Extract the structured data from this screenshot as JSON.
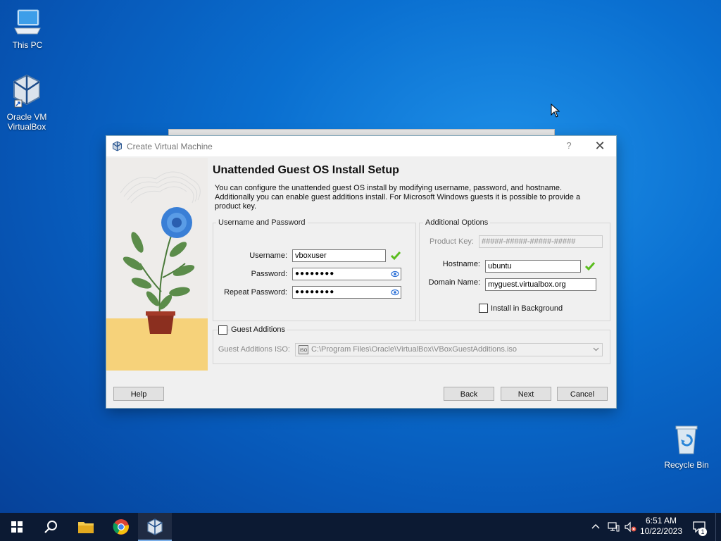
{
  "desktop": {
    "icons": [
      {
        "label": "This PC"
      },
      {
        "label": "Oracle VM VirtualBox"
      },
      {
        "label": "Recycle Bin"
      }
    ]
  },
  "dialog": {
    "title": "Create Virtual Machine",
    "help_glyph": "?",
    "close_glyph": "✕",
    "heading": "Unattended Guest OS Install Setup",
    "description": "You can configure the unattended guest OS install by modifying username, password, and hostname. Additionally you can enable guest additions install. For Microsoft Windows guests it is possible to provide a product key.",
    "user_group": {
      "title": "Username and Password",
      "username_label": "Username:",
      "username_value": "vboxuser",
      "password_label": "Password:",
      "password_value": "●●●●●●●●",
      "repeat_label": "Repeat Password:",
      "repeat_value": "●●●●●●●●"
    },
    "options_group": {
      "title": "Additional Options",
      "product_key_label": "Product Key:",
      "product_key_placeholder": "#####-#####-#####-#####",
      "hostname_label": "Hostname:",
      "hostname_value": "ubuntu",
      "domain_label": "Domain Name:",
      "domain_value": "myguest.virtualbox.org",
      "install_bg_label": "Install in Background",
      "install_bg_checked": false
    },
    "guest_additions": {
      "label": "Guest Additions",
      "checked": false,
      "iso_label": "Guest Additions ISO:",
      "iso_path": "C:\\Program Files\\Oracle\\VirtualBox\\VBoxGuestAdditions.iso"
    },
    "buttons": {
      "help": "Help",
      "back": "Back",
      "next": "Next",
      "cancel": "Cancel"
    }
  },
  "taskbar": {
    "time": "6:51 AM",
    "date": "10/22/2023",
    "notification_count": "1"
  },
  "colors": {
    "desktop_blue": "#0a6fd0",
    "taskbar": "#0c1a33",
    "check_green": "#5bbd1f",
    "eye_blue": "#2a6fd6"
  }
}
